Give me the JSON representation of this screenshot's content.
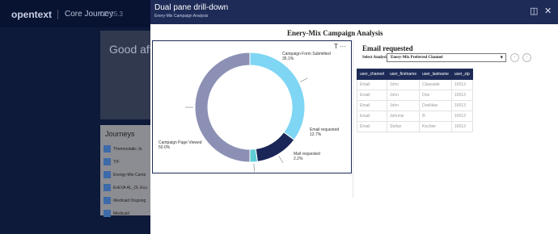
{
  "background": {
    "logo": "opentext",
    "product": "Core Journey",
    "version": "CE 25.3",
    "greeting": "Good after",
    "journeys": {
      "title": "Journeys",
      "items": [
        "Thermostatic Jo",
        "TIF",
        "Energy-Mix-Camp",
        "EnEVA AL_Ol, Ecu",
        "Medicaid Ongoing",
        "Medicaid"
      ]
    }
  },
  "modal": {
    "title": "Dual pane drill-down",
    "subtitle": "Enery-Mix Campaign Analysis",
    "chart_title": "Enery-Mix Campaign Analysis",
    "chart_toolbar": "T ···"
  },
  "chart_data": {
    "type": "pie",
    "title": "Enery-Mix Campaign Analysis",
    "labels": [
      "Campaign Form Submitted",
      "Email requested",
      "Mail requested",
      "Campaign Page Viewed"
    ],
    "values": [
      35.1,
      12.7,
      2.2,
      50.0
    ],
    "value_labels": [
      "35.1%",
      "12.7%",
      "2.2%",
      "50.0%"
    ],
    "colors": [
      "#7fd6f4",
      "#1a2658",
      "#5fcdd4",
      "#8c90b4"
    ],
    "donut": true
  },
  "detail": {
    "title": "Email requested",
    "select_label": "Select Analysis",
    "select_value": "Enery-Mix Preferred Channel",
    "columns": [
      "user_channel",
      "user_firstname",
      "user_lastname",
      "user_zip"
    ],
    "rows": [
      [
        "Email",
        "John",
        "Classside",
        "10013"
      ],
      [
        "Email",
        "John",
        "Doe",
        "10013"
      ],
      [
        "Email",
        "John",
        "DoeNew",
        "10013"
      ],
      [
        "Email",
        "Johnnie",
        "B.",
        "10013"
      ],
      [
        "Email",
        "Stefan",
        "Kochler",
        "10013"
      ]
    ]
  },
  "colors": {
    "header": "#1e2b57",
    "table_header": "#1e2b57"
  }
}
